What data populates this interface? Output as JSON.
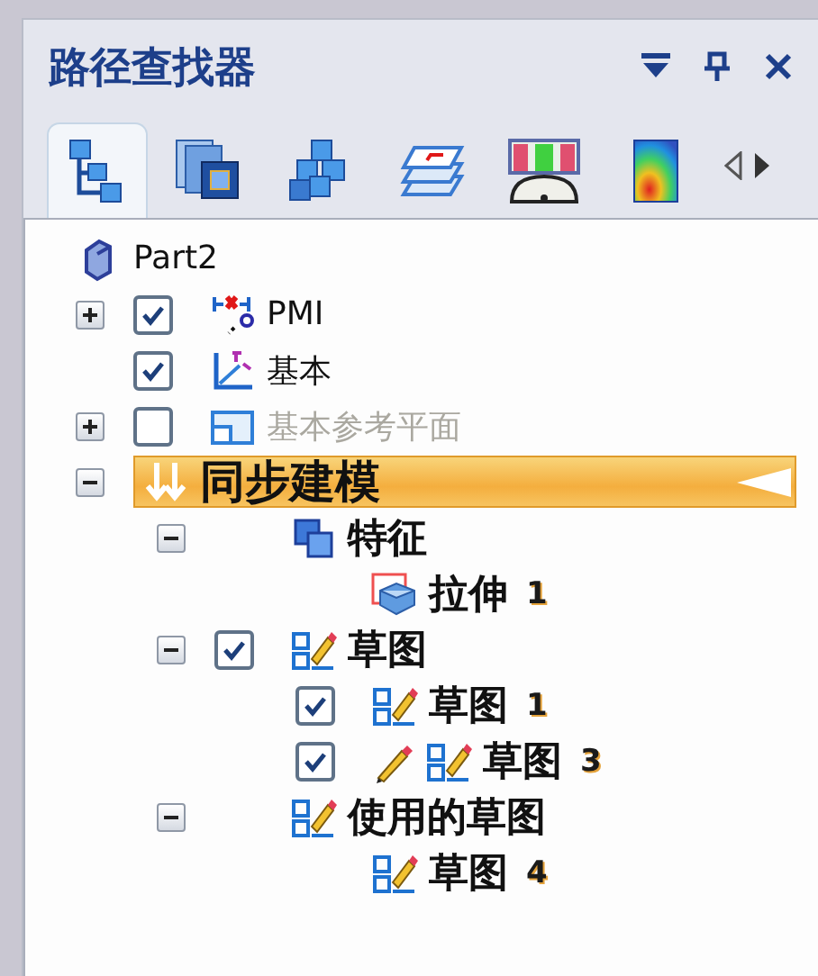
{
  "panel": {
    "title": "路径查找器"
  },
  "tabs": [
    {
      "kind": "tree",
      "selected": true
    },
    {
      "kind": "layers",
      "selected": false
    },
    {
      "kind": "blocks",
      "selected": false
    },
    {
      "kind": "sheets",
      "selected": false
    },
    {
      "kind": "gauge",
      "selected": false
    },
    {
      "kind": "heatmap",
      "selected": false
    }
  ],
  "tree": {
    "label": "Part2",
    "kind": "part",
    "children": [
      {
        "label": "PMI",
        "kind": "pmi",
        "expanded": false,
        "checked": true,
        "disabled": false
      },
      {
        "label": "基本",
        "kind": "axes",
        "checked": true,
        "disabled": false
      },
      {
        "label": "基本参考平面",
        "kind": "plane",
        "expanded": false,
        "checked": false,
        "disabled": true
      },
      {
        "label": "同步建模",
        "kind": "sync",
        "expanded": true,
        "highlighted": true,
        "disabled": false,
        "children": [
          {
            "label": "特征",
            "kind": "features",
            "expanded": true,
            "children": [
              {
                "label": "拉伸",
                "suffix": "1",
                "kind": "extrude"
              }
            ]
          },
          {
            "label": "草图",
            "kind": "sketch",
            "expanded": true,
            "checked": true,
            "children": [
              {
                "label": "草图",
                "suffix": "1",
                "kind": "sketch",
                "checked": true,
                "editing": false
              },
              {
                "label": "草图",
                "suffix": "3",
                "kind": "sketch",
                "checked": true,
                "editing": true
              }
            ]
          },
          {
            "label": "使用的草图",
            "kind": "sketch",
            "expanded": true,
            "children": [
              {
                "label": "草图",
                "suffix": "4",
                "kind": "sketch"
              }
            ]
          }
        ]
      }
    ]
  }
}
